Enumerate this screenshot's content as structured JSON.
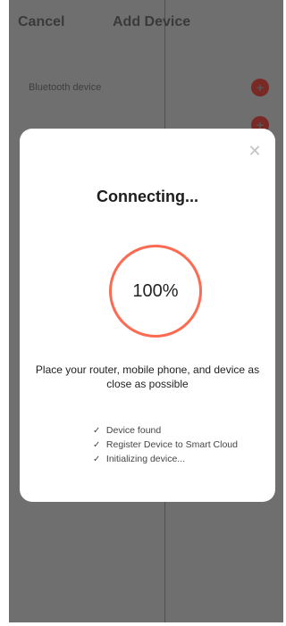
{
  "nav": {
    "cancel_label": "Cancel",
    "title": "Add Device"
  },
  "list": {
    "items": [
      {
        "label": "Bluetooth device"
      }
    ]
  },
  "dialog": {
    "close_glyph": "✕",
    "title": "Connecting...",
    "progress_text": "100%",
    "progress_percent": 100,
    "hint": "Place your router, mobile phone, and device as close as possible",
    "steps": [
      {
        "label": "Device found"
      },
      {
        "label": "Register Device to Smart Cloud"
      },
      {
        "label": "Initializing device..."
      }
    ],
    "check_glyph": "✓"
  },
  "colors": {
    "accent": "#ff6a52",
    "overlay": "#6f6f6f"
  }
}
